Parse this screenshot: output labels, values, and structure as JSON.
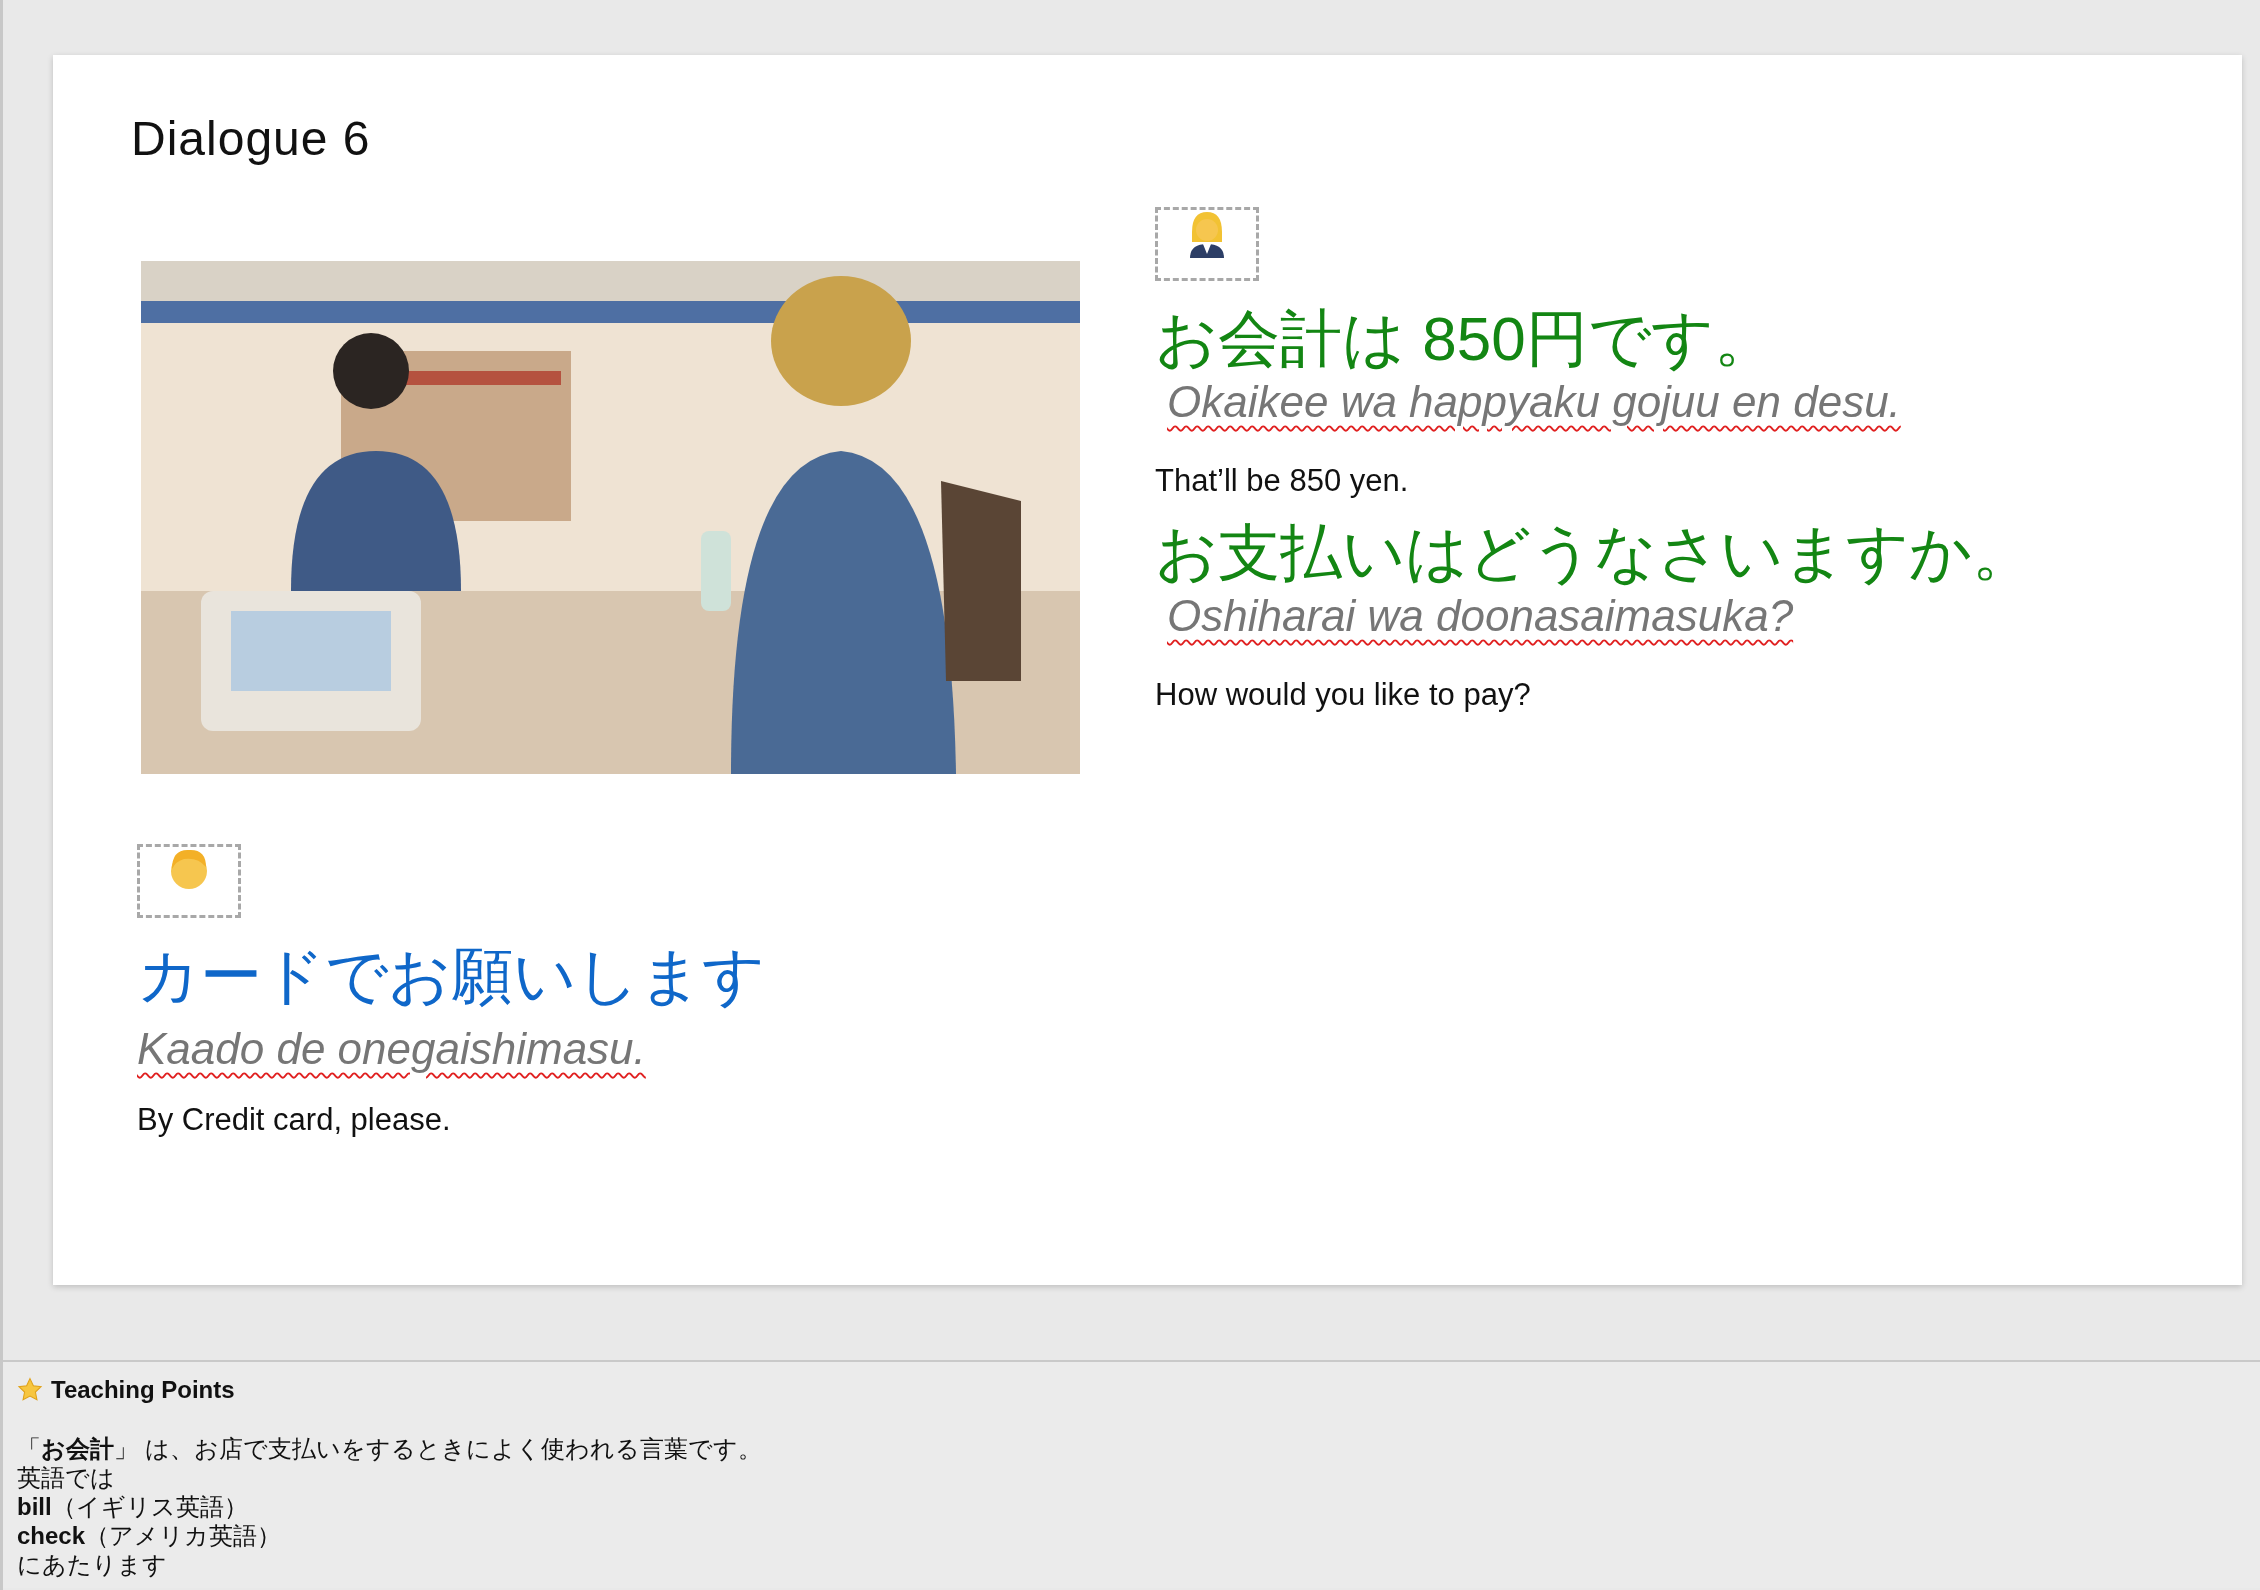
{
  "slide": {
    "title": "Dialogue 6",
    "speakers": [
      {
        "kind": "clerk",
        "color": "#138613",
        "lines": [
          {
            "japanese": "お会計は 850円です。",
            "romaji": "Okaikee wa happyaku gojuu en desu.",
            "spell_error": true,
            "english": "That’ll be 850 yen."
          },
          {
            "japanese": "お支払いはどうなさいますか。",
            "romaji": "Oshiharai wa doonasaimasuka?",
            "spell_error": true,
            "english": "How would you like to pay?"
          }
        ]
      },
      {
        "kind": "customer",
        "color": "#0f67c9",
        "lines": [
          {
            "japanese": "カードでお願いします",
            "romaji": "Kaado de onegaishimasu.",
            "spell_error": true,
            "english": "By Credit card, please."
          }
        ]
      }
    ]
  },
  "notes": {
    "heading": "Teaching Points",
    "lines": [
      "「**お会計**」 は、お店で支払いをするときによく使われる言葉です。",
      "英語では",
      "**bill**（イギリス英語）",
      "**check**（アメリカ英語）",
      "にあたります"
    ]
  }
}
